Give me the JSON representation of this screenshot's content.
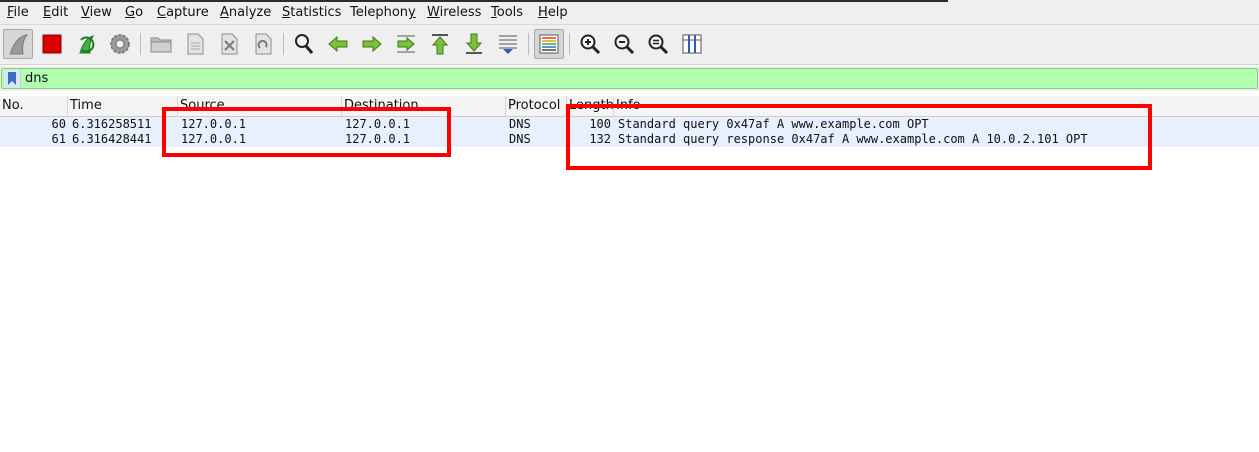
{
  "menu": [
    {
      "pre": "",
      "mn": "F",
      "post": "ile"
    },
    {
      "pre": "",
      "mn": "E",
      "post": "dit"
    },
    {
      "pre": "",
      "mn": "V",
      "post": "iew"
    },
    {
      "pre": "",
      "mn": "G",
      "post": "o"
    },
    {
      "pre": "",
      "mn": "C",
      "post": "apture"
    },
    {
      "pre": "",
      "mn": "A",
      "post": "nalyze"
    },
    {
      "pre": "",
      "mn": "S",
      "post": "tatistics"
    },
    {
      "pre": "Telephon",
      "mn": "y",
      "post": ""
    },
    {
      "pre": "",
      "mn": "W",
      "post": "ireless"
    },
    {
      "pre": "",
      "mn": "T",
      "post": "ools"
    },
    {
      "pre": "",
      "mn": "H",
      "post": "elp"
    }
  ],
  "toolbar": {
    "icons": [
      "shark-fin-start-icon",
      "stop-capture-icon",
      "restart-capture-icon",
      "capture-options-gear-icon",
      "open-file-icon",
      "save-file-icon",
      "close-file-icon",
      "reload-file-icon",
      "find-packet-icon",
      "go-back-icon",
      "go-forward-icon",
      "go-to-packet-icon",
      "first-packet-icon",
      "last-packet-icon",
      "auto-scroll-icon",
      "colorize-icon",
      "zoom-in-icon",
      "zoom-out-icon",
      "normal-size-icon",
      "resize-columns-icon"
    ]
  },
  "filter": {
    "value": "dns"
  },
  "columns": [
    "No.",
    "Time",
    "Source",
    "Destination",
    "Protocol",
    "Length",
    "Info"
  ],
  "packets": [
    {
      "no": "60",
      "time": "6.316258511",
      "source": "127.0.0.1",
      "destination": "127.0.0.1",
      "protocol": "DNS",
      "length": "100",
      "info": "Standard query 0x47af A www.example.com OPT"
    },
    {
      "no": "61",
      "time": "6.316428441",
      "source": "127.0.0.1",
      "destination": "127.0.0.1",
      "protocol": "DNS",
      "length": "132",
      "info": "Standard query response 0x47af A www.example.com A 10.0.2.101 OPT"
    }
  ],
  "colors": {
    "filter_valid": "#afffaf",
    "row_bg": "#e7f0fc",
    "highlight": "#ff0000"
  }
}
